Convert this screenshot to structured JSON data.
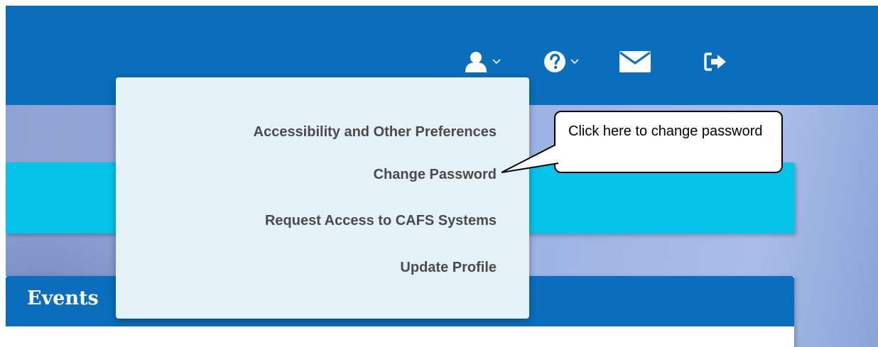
{
  "header": {
    "icons": [
      {
        "name": "user-icon",
        "has_caret": true
      },
      {
        "name": "help-icon",
        "has_caret": true
      },
      {
        "name": "mail-icon",
        "has_caret": false
      },
      {
        "name": "logout-icon",
        "has_caret": false
      }
    ]
  },
  "user_menu": {
    "items": [
      {
        "label": "Accessibility and Other Preferences"
      },
      {
        "label": "Change Password"
      },
      {
        "label": "Request Access to CAFS Systems"
      },
      {
        "label": "Update Profile"
      }
    ]
  },
  "events_panel": {
    "title": "Events"
  },
  "callout": {
    "text": "Click here to change password"
  },
  "colors": {
    "header_blue": "#0a6ebd",
    "menu_bg": "#e4f2f8",
    "cyan_band": "#06c3ea",
    "menu_text": "#4a4a4a"
  }
}
